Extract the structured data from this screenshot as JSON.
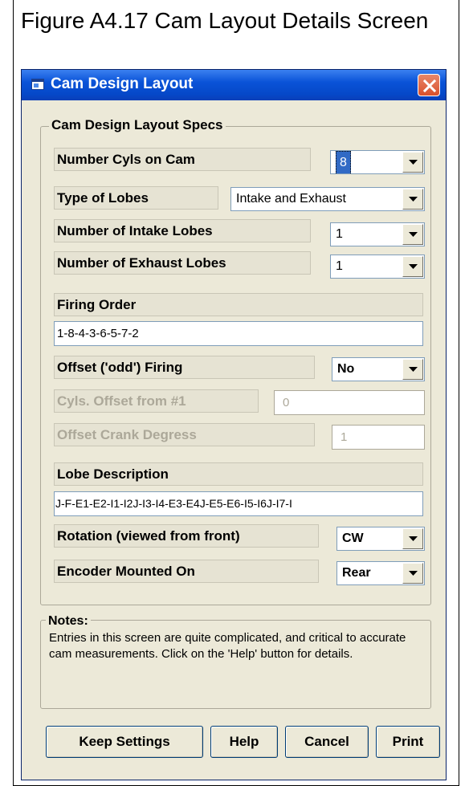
{
  "figure": {
    "caption": "Figure A4.17  Cam Layout Details Screen"
  },
  "window": {
    "title": "Cam Design Layout",
    "icon": "app-window-icon",
    "close_icon": "close-icon"
  },
  "group": {
    "title": "Cam Design Layout Specs"
  },
  "fields": {
    "num_cyls": {
      "label": "Number Cyls on Cam",
      "value": "8"
    },
    "lobe_type": {
      "label": "Type of Lobes",
      "value": "Intake and Exhaust"
    },
    "intake_lobes": {
      "label": "Number of Intake Lobes",
      "value": "1"
    },
    "exhaust_lobes": {
      "label": "Number of Exhaust Lobes",
      "value": "1"
    },
    "firing_order": {
      "label": "Firing Order",
      "value": "1-8-4-3-6-5-7-2"
    },
    "offset_firing": {
      "label": "Offset ('odd') Firing",
      "value": "No"
    },
    "cyls_offset": {
      "label": "Cyls. Offset from #1",
      "value": "0"
    },
    "offset_crank": {
      "label": "Offset Crank Degress",
      "value": "1"
    },
    "lobe_description": {
      "label": "Lobe Description",
      "value": "J-F-E1-E2-I1-I2J-I3-I4-E3-E4J-E5-E6-I5-I6J-I7-I"
    },
    "rotation": {
      "label": "Rotation (viewed from front)",
      "value": "CW"
    },
    "encoder": {
      "label": "Encoder Mounted On",
      "value": "Rear"
    }
  },
  "notes": {
    "title": "Notes:",
    "text": "Entries in this screen are quite complicated, and critical to accurate cam measurements.  Click on the 'Help' button for details."
  },
  "buttons": {
    "keep": "Keep Settings",
    "help": "Help",
    "cancel": "Cancel",
    "print": "Print"
  },
  "colors": {
    "titlebar": "#0548c8",
    "window_bg": "#ece9d8",
    "close_button": "#d9512c",
    "selection": "#316ac5"
  }
}
